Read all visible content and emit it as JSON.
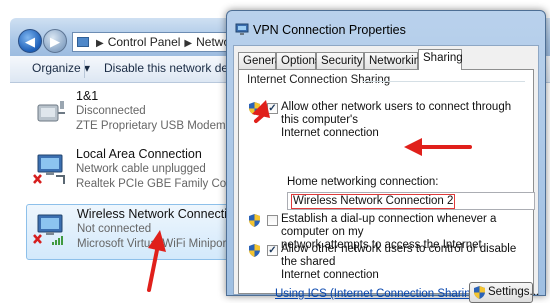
{
  "explorer": {
    "breadcrumb": [
      "Control Panel",
      "Network a"
    ],
    "toolbar": {
      "organize": "Organize ▾",
      "disable": "Disable this network device"
    },
    "connections": [
      {
        "name": "1&1",
        "status": "Disconnected",
        "device": "ZTE Proprietary USB Modem",
        "icon": "modem-connection-icon",
        "error": false,
        "selected": false
      },
      {
        "name": "Local Area Connection",
        "status": "Network cable unplugged",
        "device": "Realtek PCIe GBE Family Controller",
        "icon": "lan-connection-icon",
        "error": true,
        "selected": false
      },
      {
        "name": "Wireless Network Connection 2",
        "status": "Not connected",
        "device": "Microsoft Virtual WiFi Miniport A",
        "icon": "wireless-connection-icon",
        "error": true,
        "selected": true
      }
    ]
  },
  "dialog": {
    "title": "VPN Connection Properties",
    "tabs": [
      "General",
      "Options",
      "Security",
      "Networking",
      "Sharing"
    ],
    "active_tab": "Sharing",
    "group_label": "Internet Connection Sharing",
    "option1": {
      "line1": "Allow other network users to connect through this computer's",
      "line2": "Internet connection",
      "checked": true
    },
    "home_label": "Home networking connection:",
    "home_value": "Wireless Network Connection 2",
    "option2": {
      "line1": "Establish a dial-up connection whenever a computer on my",
      "line2": "network attempts to access the Internet",
      "checked": false
    },
    "option3": {
      "line1": "Allow other network users to control or disable the shared",
      "line2": "Internet connection",
      "checked": true
    },
    "link": "Using ICS (Internet Connection Sharing)",
    "settings_button": "Settings..."
  },
  "colors": {
    "annotation": "#e0201b",
    "link": "#0645ad",
    "title_bar": "#a9c6e6"
  }
}
